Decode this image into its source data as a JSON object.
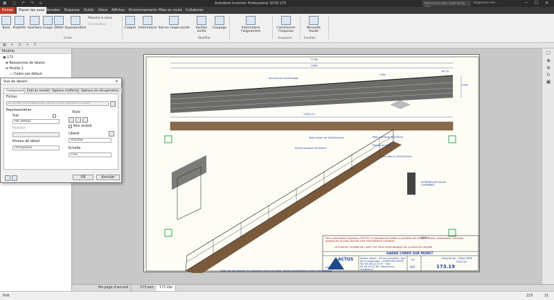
{
  "window": {
    "title": "Autodesk Inventor Professional 2018   173",
    "search_placeholder": "Rechercher dans l'aide et les com",
    "user": "bs@actus-ma..."
  },
  "menu": {
    "file": "Fichier",
    "tabs": [
      "Placer les vues",
      "Annoter",
      "Esquisse",
      "Outils",
      "Gérer",
      "Afficher",
      "Environnements",
      "Mise en route",
      "Collaborer"
    ]
  },
  "ribbon": {
    "creer": {
      "base": "Base",
      "projetee": "Projetée",
      "auxiliaire": "Auxiliaire",
      "coupe": "Coupe",
      "detail": "Détail",
      "superposition": "Superposition",
      "planche": "Planche à clous",
      "connecteur": "Connecteur",
      "label": "Créer"
    },
    "modifier": {
      "croquis": "Croquis",
      "interrompre": "Interrompre",
      "vue_coupe_locale": "Vue en coupe locale",
      "section_sortie": "Section sortie",
      "coupage": "Coupage",
      "label": "Modifier"
    },
    "interrompre_alignement": "Interrompre l'alignement",
    "esquisse": {
      "commencer": "Commencer l'esquisse",
      "label": "Esquisse"
    },
    "feuilles": {
      "nouvelle": "Nouvelle feuille",
      "label": "Feuilles"
    }
  },
  "browser": {
    "title": "Modèle",
    "items": [
      "173",
      "Ressources de dessin",
      "Feuille:1",
      "Cadre par défaut"
    ]
  },
  "dialog": {
    "title": "Vue de dessin",
    "tabs": [
      "Composant",
      "Etat du modèle",
      "Options d'affichage",
      "Options de récupération"
    ],
    "fichier_label": "Fichier",
    "fichier_value": "D:\\PLAN ACUS\\Nouveau garde-corps gardes\\173.iam",
    "representation_label": "Représentation",
    "vue_label": "Vue",
    "vue_value": "Par défaut",
    "position_label": "Position",
    "niveau_label": "Niveau de détail",
    "niveau_value": "Principal(e)",
    "style_label": "Style",
    "non_ombre": "Non ombré",
    "libelle_label": "Libellé",
    "libelle_value": "VUE456",
    "echelle_label": "Echelle",
    "echelle_value": "0.02",
    "ok": "OK",
    "cancel": "Annuler"
  },
  "drawing": {
    "dims": {
      "d1": "17760",
      "d2": "17667",
      "d3": "17670,74",
      "d4": "1280",
      "d5": "1900",
      "d6": "65,75"
    },
    "notes": [
      "Taille maille de 100x50x4mm",
      "Main courante 40x40mm",
      "Profile montant 40x40mm",
      "Platine de fixation",
      "Croix tube en 30x30x2mm",
      "ASSEMBLAGE Soudé CHAMBRES"
    ],
    "jonction": "jonction par boulonnage",
    "title_block": {
      "warning": "Sans autorisation expresse d'ACTUS, la reproduction totale ou partielle des images, textes, illustrations, concepts graphiques et plans donnés sont formellement interdites.",
      "disclaimer": "LE POSEUR \"HOMME DE L'ART\" EST SEUL RESPONSABLE DE LA MISE EN OEUVRE",
      "project": "GARDE CORPS SUR MURET",
      "poste": "Poste :",
      "company": "ACTUS",
      "company_sub": "Atelier métal",
      "address": "Atelier urbain · ZA les Loncelets · Rue de la Languedoc · 33400 MELLECHE · Tel: 05.56.13.37.37 · Fax: 05.56.13.37.38 · www.actus-metallier.fr",
      "ref_label": "Réf",
      "ref": "173.19",
      "format": "A3",
      "designer": "Dessiné par : Alban PERE",
      "date": "19/01/18"
    },
    "footnote": "Nota: Ne pas réaliser ou reproduire sans nos cotes, toutes modifications seront considérées."
  },
  "doc_tabs": [
    "Ma page d'accueil",
    "173.iam",
    "173.idw"
  ],
  "status": {
    "left": "Prêt",
    "num1": "225",
    "num2": "31"
  }
}
